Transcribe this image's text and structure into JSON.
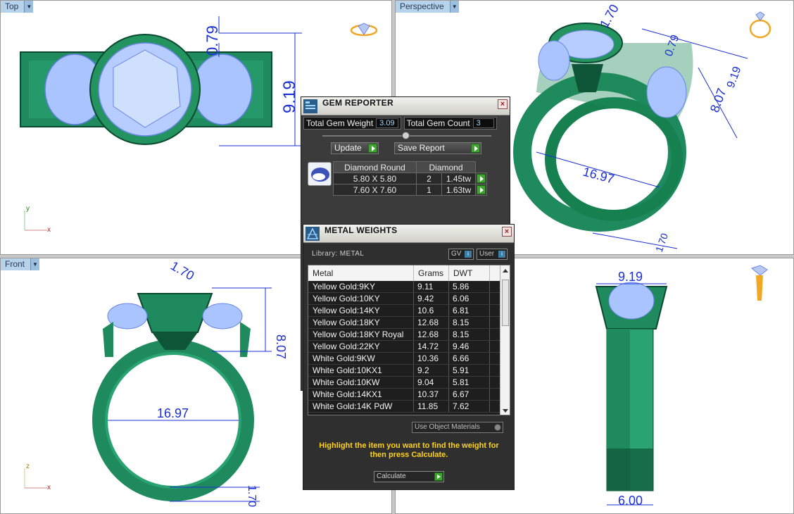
{
  "viewports": {
    "top": {
      "label": "Top",
      "dims": [
        "0.79",
        "9.19"
      ]
    },
    "perspective": {
      "label": "Perspective",
      "dims": [
        "1.70",
        "0.79",
        "9.19",
        "8.07",
        "16.97",
        "1.70"
      ]
    },
    "front": {
      "label": "Front",
      "dims": [
        "1.70",
        "8.07",
        "16.97",
        "1.70"
      ]
    },
    "right": {
      "dims": [
        "9.19",
        "6.00"
      ]
    }
  },
  "axes": {
    "y": "y",
    "x": "x",
    "z": "z"
  },
  "gem_reporter": {
    "title": "GEM REPORTER",
    "total_weight_label": "Total Gem Weight",
    "total_weight_value": "3.09",
    "total_count_label": "Total Gem Count",
    "total_count_value": "3",
    "update_label": "Update",
    "save_report_label": "Save Report",
    "table": {
      "headers": [
        "Diamond Round",
        "Diamond"
      ],
      "rows": [
        {
          "size": "5.80 X 5.80",
          "count": "2",
          "weight": "1.45tw"
        },
        {
          "size": "7.60 X 7.60",
          "count": "1",
          "weight": "1.63tw"
        }
      ]
    }
  },
  "metal_weights": {
    "title": "METAL WEIGHTS",
    "library_label": "Library: METAL",
    "gv_label": "GV",
    "user_label": "User",
    "headers": {
      "metal": "Metal",
      "grams": "Grams",
      "dwt": "DWT"
    },
    "rows": [
      {
        "metal": "Yellow Gold:9KY",
        "grams": "9.11",
        "dwt": "5.86"
      },
      {
        "metal": "Yellow Gold:10KY",
        "grams": "9.42",
        "dwt": "6.06"
      },
      {
        "metal": "Yellow Gold:14KY",
        "grams": "10.6",
        "dwt": "6.81"
      },
      {
        "metal": "Yellow Gold:18KY",
        "grams": "12.68",
        "dwt": "8.15"
      },
      {
        "metal": "Yellow Gold:18KY Royal",
        "grams": "12.68",
        "dwt": "8.15"
      },
      {
        "metal": "Yellow Gold:22KY",
        "grams": "14.72",
        "dwt": "9.46"
      },
      {
        "metal": "White Gold:9KW",
        "grams": "10.36",
        "dwt": "6.66"
      },
      {
        "metal": "White Gold:10KX1",
        "grams": "9.2",
        "dwt": "5.91"
      },
      {
        "metal": "White Gold:10KW",
        "grams": "9.04",
        "dwt": "5.81"
      },
      {
        "metal": "White Gold:14KX1",
        "grams": "10.37",
        "dwt": "6.67"
      },
      {
        "metal": "White Gold:14K PdW",
        "grams": "11.85",
        "dwt": "7.62"
      }
    ],
    "use_object_materials_label": "Use Object Materials",
    "hint": "Highlight the item you want to find the weight for then press Calculate.",
    "calculate_label": "Calculate"
  },
  "colors": {
    "metal_green": "#1f8a5e",
    "gem_blue": "#a9c4ff",
    "dimension_blue": "#1a2fd6",
    "panel_dark": "#3b3b3b",
    "hint_yellow": "#ffd21a"
  }
}
